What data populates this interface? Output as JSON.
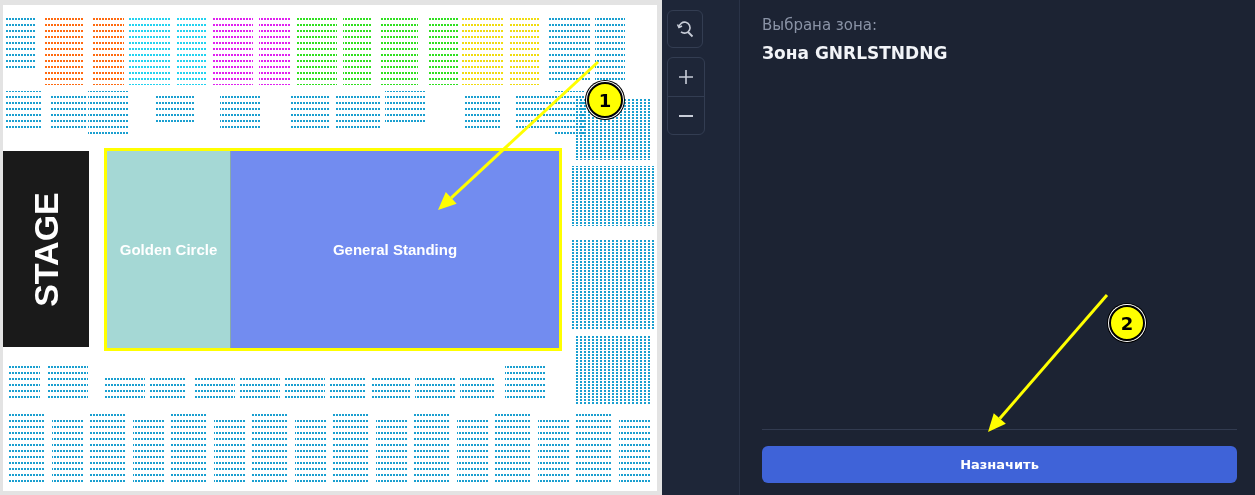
{
  "seat_map": {
    "stage_label": "STAGE",
    "zones": [
      {
        "label": "Golden Circle",
        "color": "#a5d8d5"
      },
      {
        "label": "General Standing",
        "color": "#728cf0"
      }
    ],
    "seat_sections": [
      {
        "color": "#1a9fd0"
      },
      {
        "color": "#ff6a10"
      },
      {
        "color": "#22d2f0"
      },
      {
        "color": "#e020f0"
      },
      {
        "color": "#30e020"
      },
      {
        "color": "#f0dc10"
      },
      {
        "color": "#1a9fd0"
      },
      {
        "color": "#1a9fd0"
      },
      {
        "color": "#1a9fd0"
      },
      {
        "color": "#1a9fd0"
      }
    ]
  },
  "annotations": [
    {
      "number": "1"
    },
    {
      "number": "2"
    }
  ],
  "panel": {
    "caption": "Выбрана зона:",
    "zone_name": "Зона GNRLSTNDNG",
    "assign_button": "Назначить"
  }
}
